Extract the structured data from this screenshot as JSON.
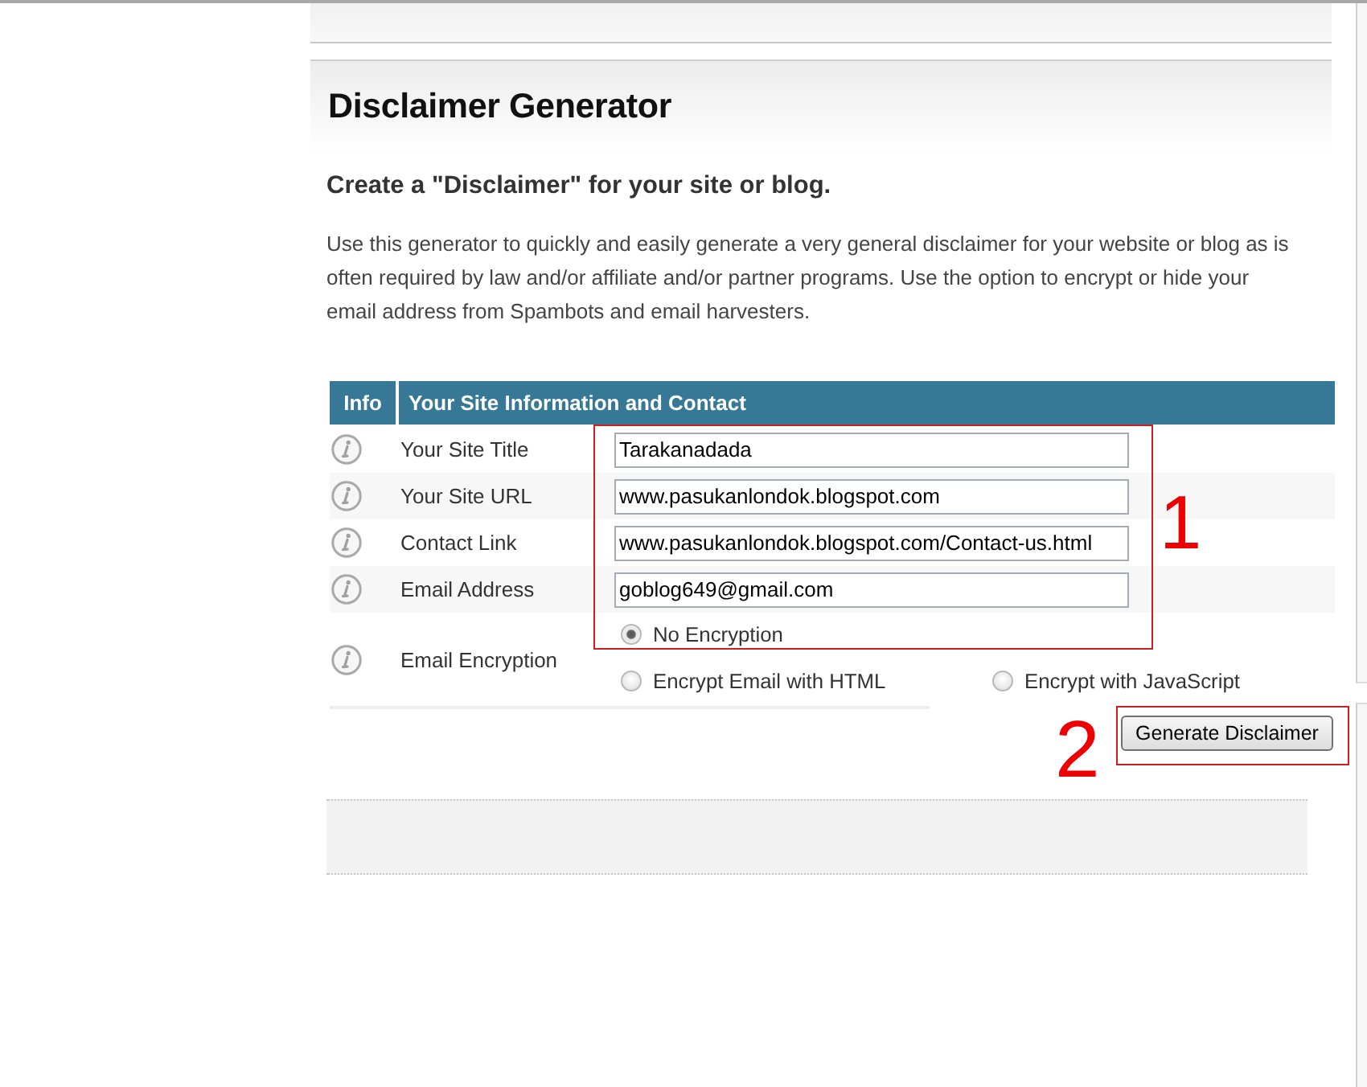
{
  "heading": "Disclaimer Generator",
  "subtitle": "Create a \"Disclaimer\" for your site or blog.",
  "description": "Use this generator to quickly and easily generate a very general disclaimer for your website or blog as is often required by law and/or affiliate and/or partner programs. Use the option to encrypt or hide your email address from Spambots and email harvesters.",
  "form": {
    "columns": [
      "Info",
      "Your Site Information and Contact"
    ],
    "fields": [
      {
        "label": "Your Site Title",
        "value": "Tarakanadada"
      },
      {
        "label": "Your Site URL",
        "value": "www.pasukanlondok.blogspot.com"
      },
      {
        "label": "Contact Link",
        "value": "www.pasukanlondok.blogspot.com/Contact-us.html"
      },
      {
        "label": "Email Address",
        "value": "goblog649@gmail.com"
      }
    ],
    "encryption": {
      "label": "Email Encryption",
      "options": [
        {
          "label": "No Encryption",
          "selected": true
        },
        {
          "label": "Encrypt Email with HTML",
          "selected": false
        },
        {
          "label": "Encrypt with JavaScript",
          "selected": false
        }
      ]
    },
    "submit": "Generate Disclaimer"
  },
  "annotations": [
    {
      "label": "1"
    },
    {
      "label": "2"
    }
  ]
}
